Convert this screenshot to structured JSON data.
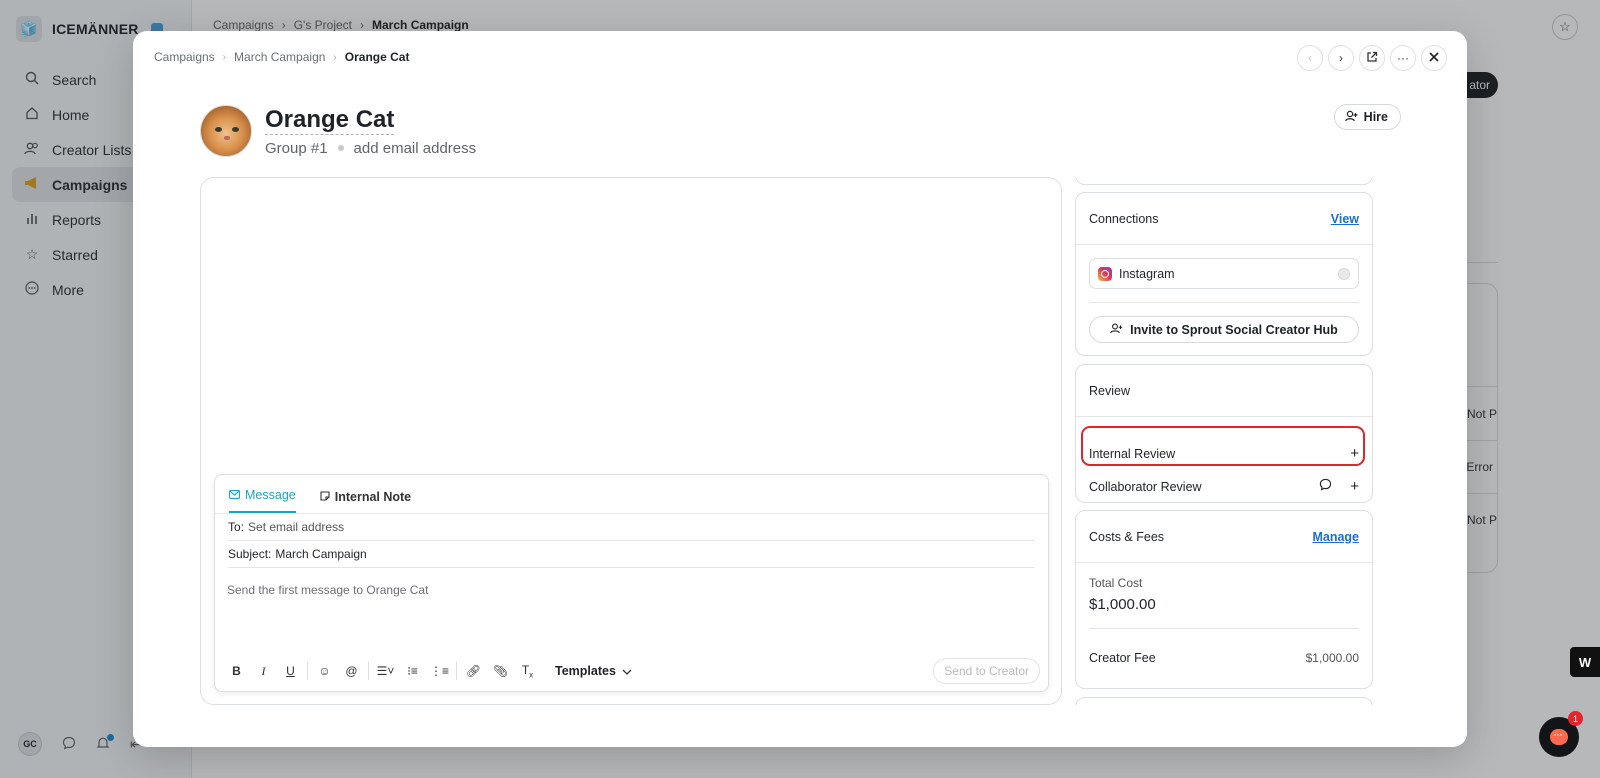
{
  "sidebar": {
    "brand": "ICEMÄNNER",
    "items": [
      {
        "label": "Search",
        "icon": "search-icon"
      },
      {
        "label": "Home",
        "icon": "home-icon"
      },
      {
        "label": "Creator Lists",
        "icon": "people-icon"
      },
      {
        "label": "Campaigns",
        "icon": "megaphone-icon"
      },
      {
        "label": "Reports",
        "icon": "bar-chart-icon"
      },
      {
        "label": "Starred",
        "icon": "star-icon"
      },
      {
        "label": "More",
        "icon": "more-icon"
      }
    ],
    "active": "Campaigns",
    "user_initials": "GC"
  },
  "background": {
    "breadcrumb": [
      "Campaigns",
      "G's Project",
      "March Campaign"
    ],
    "pill_text": "ator",
    "cells": [
      "Not P",
      "Error",
      "Not P"
    ]
  },
  "modal": {
    "breadcrumb": [
      "Campaigns",
      "March Campaign",
      "Orange Cat"
    ],
    "creator": {
      "name": "Orange Cat",
      "group": "Group #1",
      "email_placeholder": "add email address"
    },
    "hire_label": "Hire",
    "composer": {
      "tabs": [
        "Message",
        "Internal Note"
      ],
      "to_label": "To:",
      "to_value": "Set email address",
      "subject_label": "Subject:",
      "subject_value": "March Campaign",
      "body_placeholder": "Send the first message to Orange Cat",
      "templates_label": "Templates",
      "send_label": "Send to Creator"
    },
    "connections": {
      "title": "Connections",
      "view_label": "View",
      "platform": "Instagram",
      "invite_label": "Invite to Sprout Social Creator Hub"
    },
    "review": {
      "title": "Review",
      "internal": "Internal Review",
      "collaborator": "Collaborator Review"
    },
    "costs": {
      "title": "Costs & Fees",
      "manage_label": "Manage",
      "total_label": "Total Cost",
      "total_value": "$1,000.00",
      "fee_label": "Creator Fee",
      "fee_value": "$1,000.00"
    }
  },
  "chat": {
    "unread": "1"
  },
  "accent_color": "#1aa4c4",
  "highlight_color": "#e0262d"
}
